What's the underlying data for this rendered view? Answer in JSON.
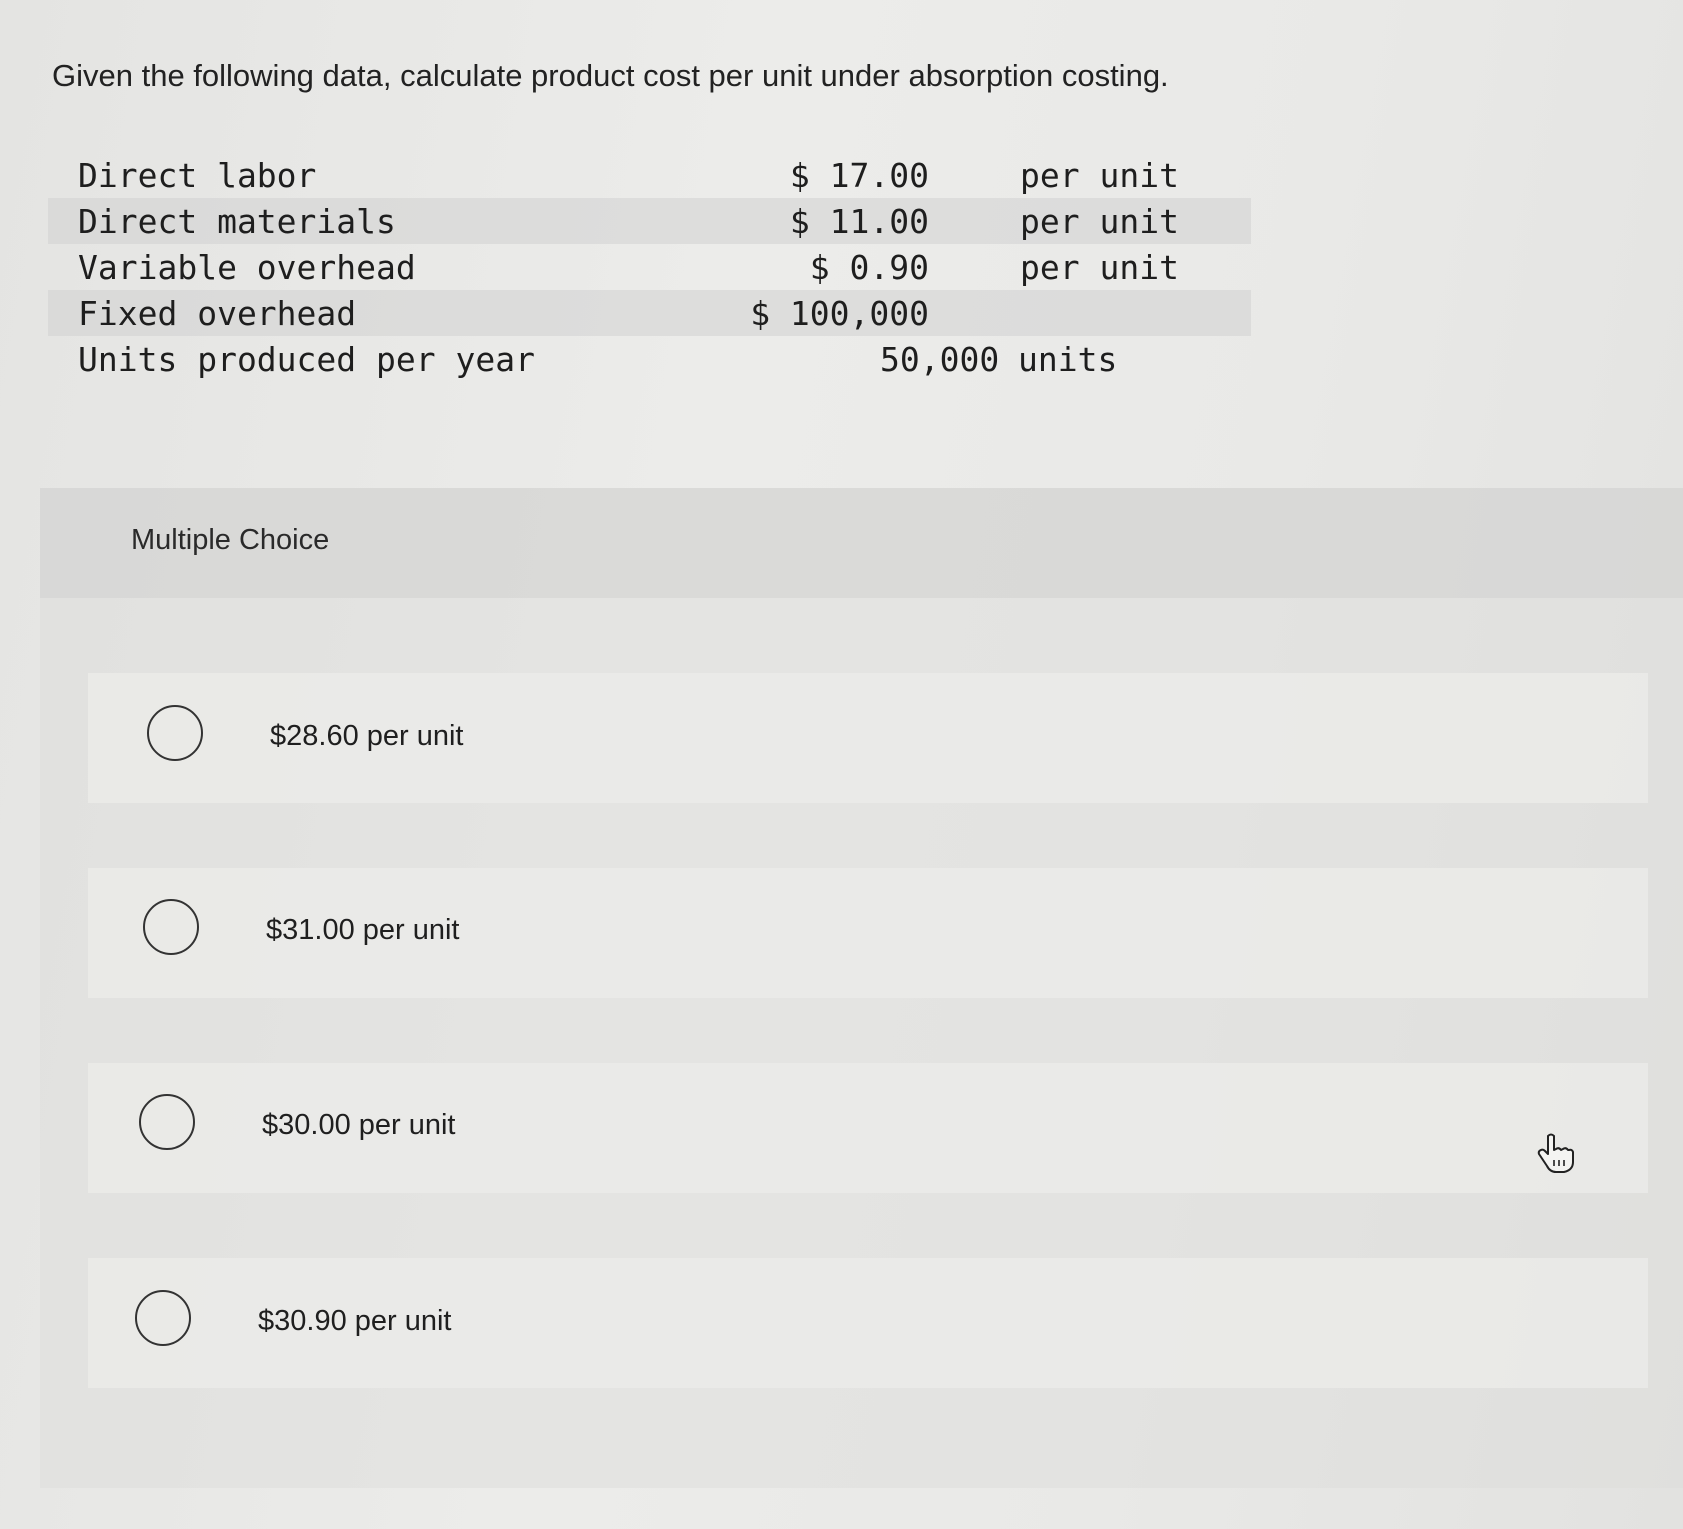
{
  "question": {
    "text": "Given the following data, calculate product cost per unit under absorption costing."
  },
  "data_table": [
    {
      "label": "Direct labor",
      "amount": "$ 17.00",
      "unit": "per unit"
    },
    {
      "label": "Direct materials",
      "amount": "$ 11.00",
      "unit": "per unit"
    },
    {
      "label": "Variable overhead",
      "amount": "$ 0.90",
      "unit": "per unit"
    },
    {
      "label": "Fixed overhead",
      "amount": "$ 100,000",
      "unit": ""
    },
    {
      "label": "Units produced per year",
      "amount": "50,000",
      "unit": "units"
    }
  ],
  "multiple_choice": {
    "title": "Multiple Choice",
    "options": [
      {
        "label": "$28.60 per unit",
        "selected": false
      },
      {
        "label": "$31.00 per unit",
        "selected": false
      },
      {
        "label": "$30.00 per unit",
        "selected": false
      },
      {
        "label": "$30.90 per unit",
        "selected": false
      }
    ]
  },
  "icons": {
    "cursor": "hand-pointer-icon"
  }
}
